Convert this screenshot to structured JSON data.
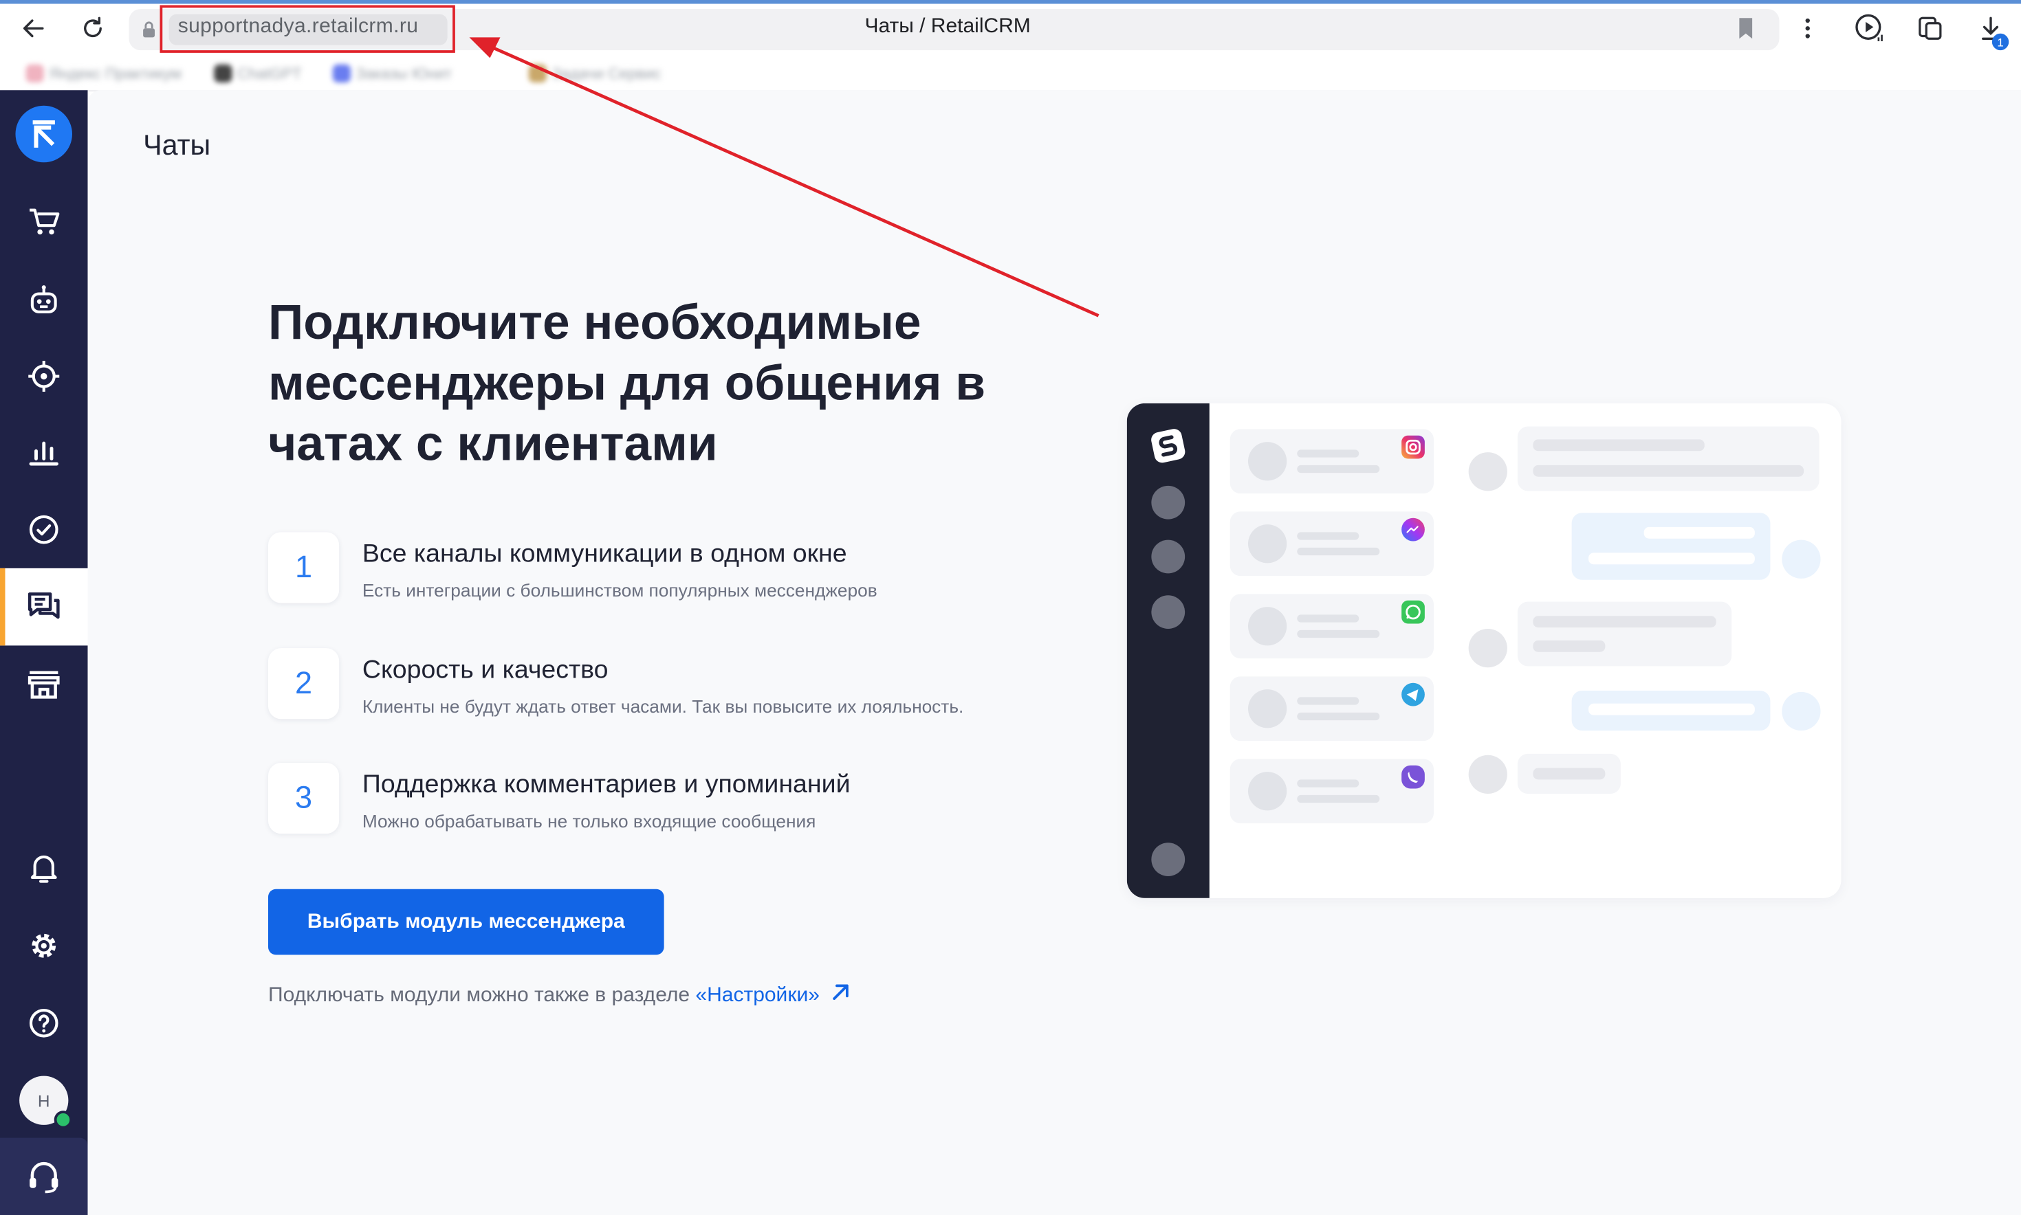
{
  "browser": {
    "url": "supportnadya.retailcrm.ru",
    "tab_title": "Чаты / RetailCRM",
    "download_count": "1",
    "bookmarks": [
      "Яндекс Практикум",
      "ChatGPT",
      "Заказы Юнит",
      "Задачи Сервис"
    ]
  },
  "sidebar": {
    "items": [
      {
        "icon": "cart-icon"
      },
      {
        "icon": "robot-icon"
      },
      {
        "icon": "target-icon"
      },
      {
        "icon": "bar-chart-icon"
      },
      {
        "icon": "check-circle-icon"
      },
      {
        "icon": "chat-icon",
        "active": true
      },
      {
        "icon": "store-icon"
      },
      {
        "icon": "bell-icon"
      },
      {
        "icon": "gear-icon"
      },
      {
        "icon": "help-icon"
      },
      {
        "icon": "headset-icon"
      }
    ],
    "avatar_initial": "Н"
  },
  "main": {
    "page_title": "Чаты",
    "headline": "Подключите необходимые мессенджеры для общения в чатах с клиентами",
    "features": [
      {
        "num": "1",
        "title": "Все каналы коммуникации в одном окне",
        "desc": "Есть интеграции с большинством популярных мессенджеров"
      },
      {
        "num": "2",
        "title": "Скорость и качество",
        "desc": "Клиенты не будут ждать ответ часами. Так вы повысите их лояльность."
      },
      {
        "num": "3",
        "title": "Поддержка комментариев и упоминаний",
        "desc": "Можно обрабатывать не только входящие сообщения"
      }
    ],
    "cta_label": "Выбрать модуль мессенджера",
    "hint_text": "Подключать модули можно также в разделе ",
    "hint_link": "«Настройки»"
  },
  "illustration": {
    "messengers": [
      "instagram-icon",
      "messenger-icon",
      "whatsapp-icon",
      "telegram-icon",
      "viber-icon"
    ]
  },
  "colors": {
    "sidebar": "#1f2246",
    "accent": "#1265e6",
    "active_marker": "#f8a531",
    "annotation": "#e0222a"
  }
}
